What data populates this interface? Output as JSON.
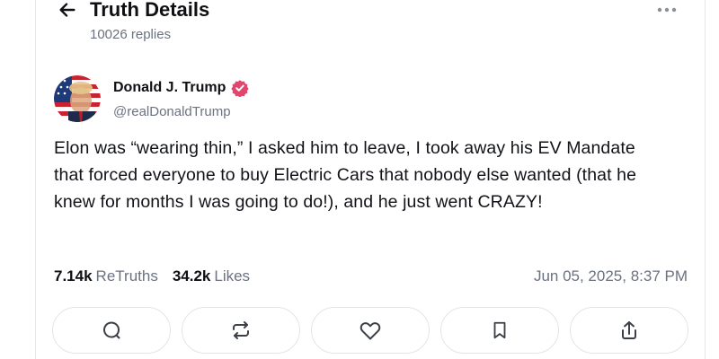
{
  "header": {
    "title": "Truth Details",
    "replies": "10026 replies"
  },
  "post": {
    "author_name": "Donald J. Trump",
    "handle": "@realDonaldTrump",
    "verified": true,
    "verified_color": "#e2456e",
    "text": "Elon was “wearing thin,” I asked him to leave, I took away his EV Mandate that forced everyone to buy Electric Cars that nobody else wanted (that he knew for months I was going to do!), and he just went CRAZY!",
    "retruths_count": "7.14k",
    "retruths_label": "ReTruths",
    "likes_count": "34.2k",
    "likes_label": "Likes",
    "timestamp": "Jun 05, 2025, 8:37 PM"
  },
  "actions": [
    {
      "name": "reply",
      "icon": "comment-icon"
    },
    {
      "name": "retruth",
      "icon": "repost-icon"
    },
    {
      "name": "like",
      "icon": "heart-icon"
    },
    {
      "name": "bookmark",
      "icon": "bookmark-icon"
    },
    {
      "name": "share",
      "icon": "share-icon"
    }
  ]
}
